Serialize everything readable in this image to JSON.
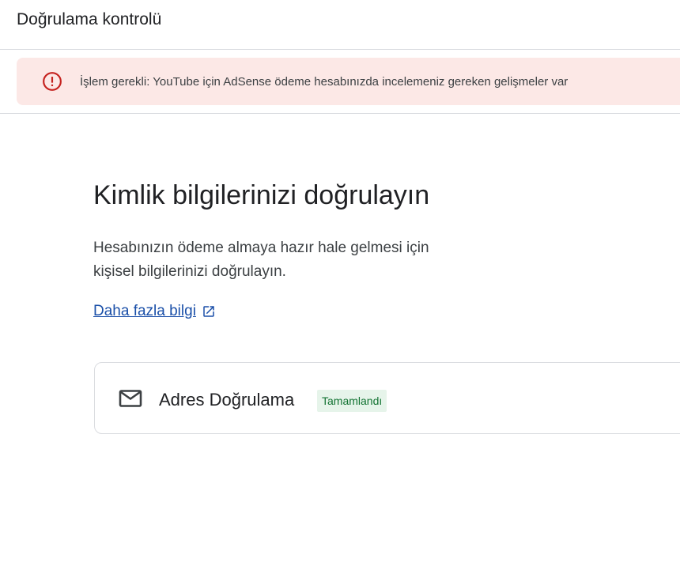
{
  "header": {
    "title": "Doğrulama kontrolü"
  },
  "alert": {
    "icon": "error-icon",
    "color": "#c5221f",
    "text": "İşlem gerekli: YouTube için AdSense ödeme hesabınızda incelemeniz gereken gelişmeler var"
  },
  "main": {
    "heading": "Kimlik bilgilerinizi doğrulayın",
    "description_line1": "Hesabınızın ödeme almaya hazır hale gelmesi için",
    "description_line2": "kişisel bilgilerinizi doğrulayın.",
    "learn_more": "Daha fazla bilgi",
    "learn_more_icon": "open-in-new-icon"
  },
  "steps": [
    {
      "icon": "mail-icon",
      "title": "Adres Doğrulama",
      "status": "Tamamlandı",
      "status_color": "#137333"
    }
  ]
}
